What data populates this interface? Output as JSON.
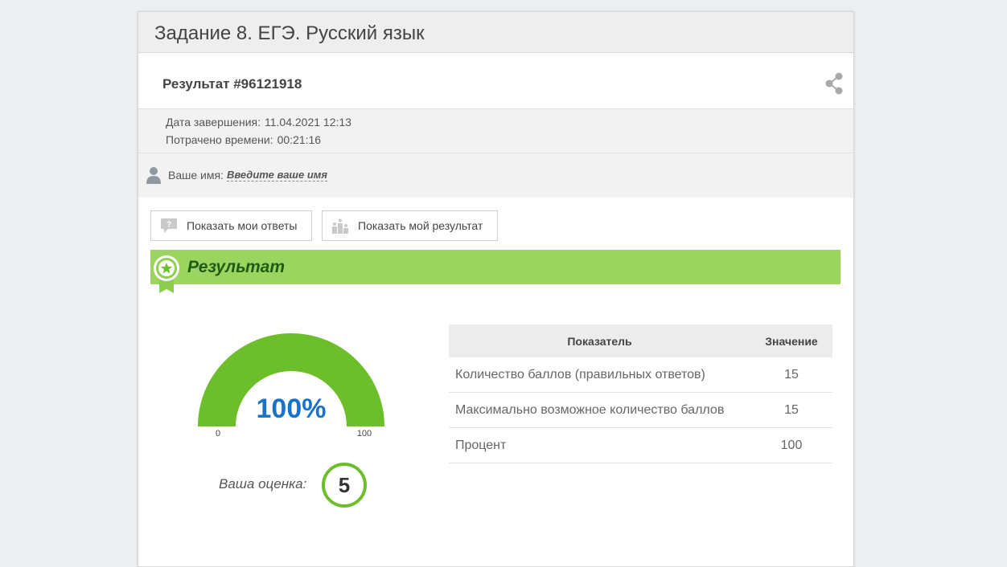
{
  "page": {
    "title": "Задание 8. ЕГЭ. Русский язык"
  },
  "result": {
    "title": "Результат #96121918"
  },
  "meta": {
    "finish_label": "Дата завершения:",
    "finish_value": "11.04.2021 12:13",
    "time_label": "Потрачено времени:",
    "time_value": "00:21:16"
  },
  "user": {
    "name_label": "Ваше имя:",
    "name_link": "Введите ваше имя"
  },
  "buttons": {
    "show_answers": "Показать мои ответы",
    "show_result": "Показать мой результат"
  },
  "banner": {
    "title": "Результат"
  },
  "gauge": {
    "value_text": "100%",
    "value": 100,
    "min": "0",
    "max": "100"
  },
  "grade": {
    "label": "Ваша оценка:",
    "value": "5"
  },
  "table": {
    "headers": [
      "Показатель",
      "Значение"
    ],
    "rows": [
      {
        "name": "Количество баллов (правильных ответов)",
        "value": "15"
      },
      {
        "name": "Максимально возможное количество баллов",
        "value": "15"
      },
      {
        "name": "Процент",
        "value": "100"
      }
    ]
  },
  "colors": {
    "accent_green": "#6cbf2a",
    "banner_green": "#9bd55f",
    "gauge_text_blue": "#1a73c9"
  },
  "icons": {
    "share": "share-icon",
    "user": "user-icon",
    "answers": "question-bubble-icon",
    "result": "podium-icon",
    "badge": "award-ribbon-icon"
  }
}
